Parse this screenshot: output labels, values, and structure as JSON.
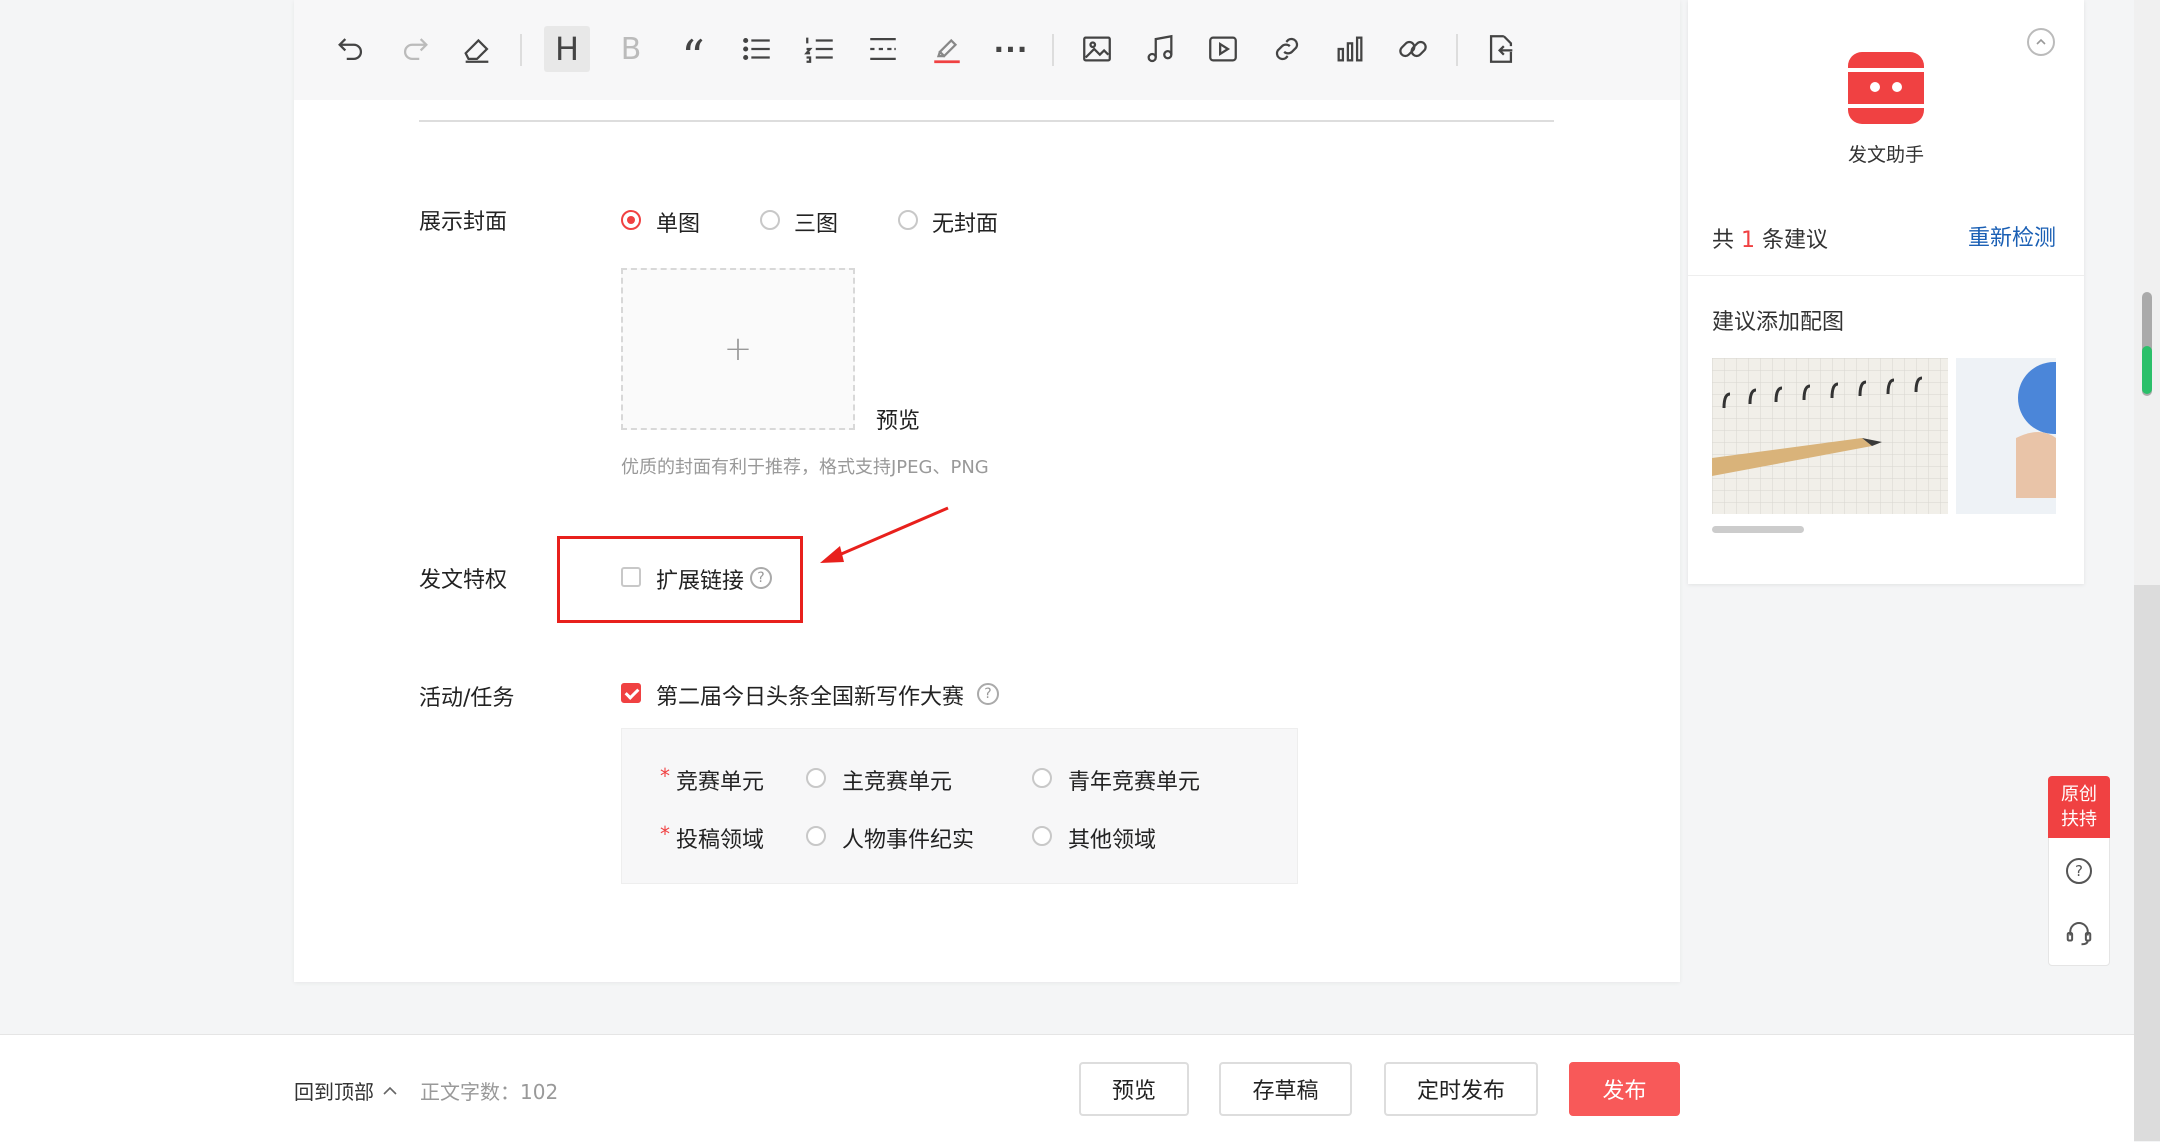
{
  "toolbar": {
    "icons": [
      "undo-icon",
      "redo-icon",
      "eraser-icon",
      "heading-icon",
      "bold-icon",
      "quote-icon",
      "bullet-list-icon",
      "numbered-list-icon",
      "divider-icon",
      "highlighter-icon",
      "more-icon",
      "image-icon",
      "music-icon",
      "video-icon",
      "link-icon",
      "chart-icon",
      "chain-link-icon",
      "import-icon"
    ],
    "heading_glyph": "H",
    "bold_glyph": "B",
    "quote_glyph": "“",
    "more_glyph": "···"
  },
  "cover": {
    "label": "展示封面",
    "options": [
      {
        "label": "单图",
        "checked": true
      },
      {
        "label": "三图",
        "checked": false
      },
      {
        "label": "无封面",
        "checked": false
      }
    ],
    "upload_plus": "+",
    "preview_label": "预览",
    "hint": "优质的封面有利于推荐，格式支持JPEG、PNG"
  },
  "privilege": {
    "label": "发文特权",
    "option_label": "扩展链接",
    "checked": false,
    "help_glyph": "?"
  },
  "activity": {
    "label": "活动/任务",
    "contest_label": "第二届今日头条全国新写作大赛",
    "checked": true,
    "help_glyph": "?",
    "rows": [
      {
        "required": "*",
        "label": "竞赛单元",
        "options": [
          "主竞赛单元",
          "青年竞赛单元"
        ]
      },
      {
        "required": "*",
        "label": "投稿领域",
        "options": [
          "人物事件纪实",
          "其他领域"
        ]
      }
    ]
  },
  "bottom": {
    "back_to_top": "回到顶部",
    "word_count_label": "正文字数：",
    "word_count": "102",
    "buttons": {
      "preview": "预览",
      "draft": "存草稿",
      "schedule": "定时发布",
      "publish": "发布"
    }
  },
  "assistant": {
    "title": "发文助手",
    "suggest_prefix": "共",
    "suggest_count": "1",
    "suggest_suffix": "条建议",
    "recheck": "重新检测",
    "add_image_title": "建议添加配图"
  },
  "float": {
    "original_line1": "原创",
    "original_line2": "扶持"
  },
  "colors": {
    "accent": "#f04142",
    "link": "#1a5fb4",
    "publish": "#f85959"
  }
}
